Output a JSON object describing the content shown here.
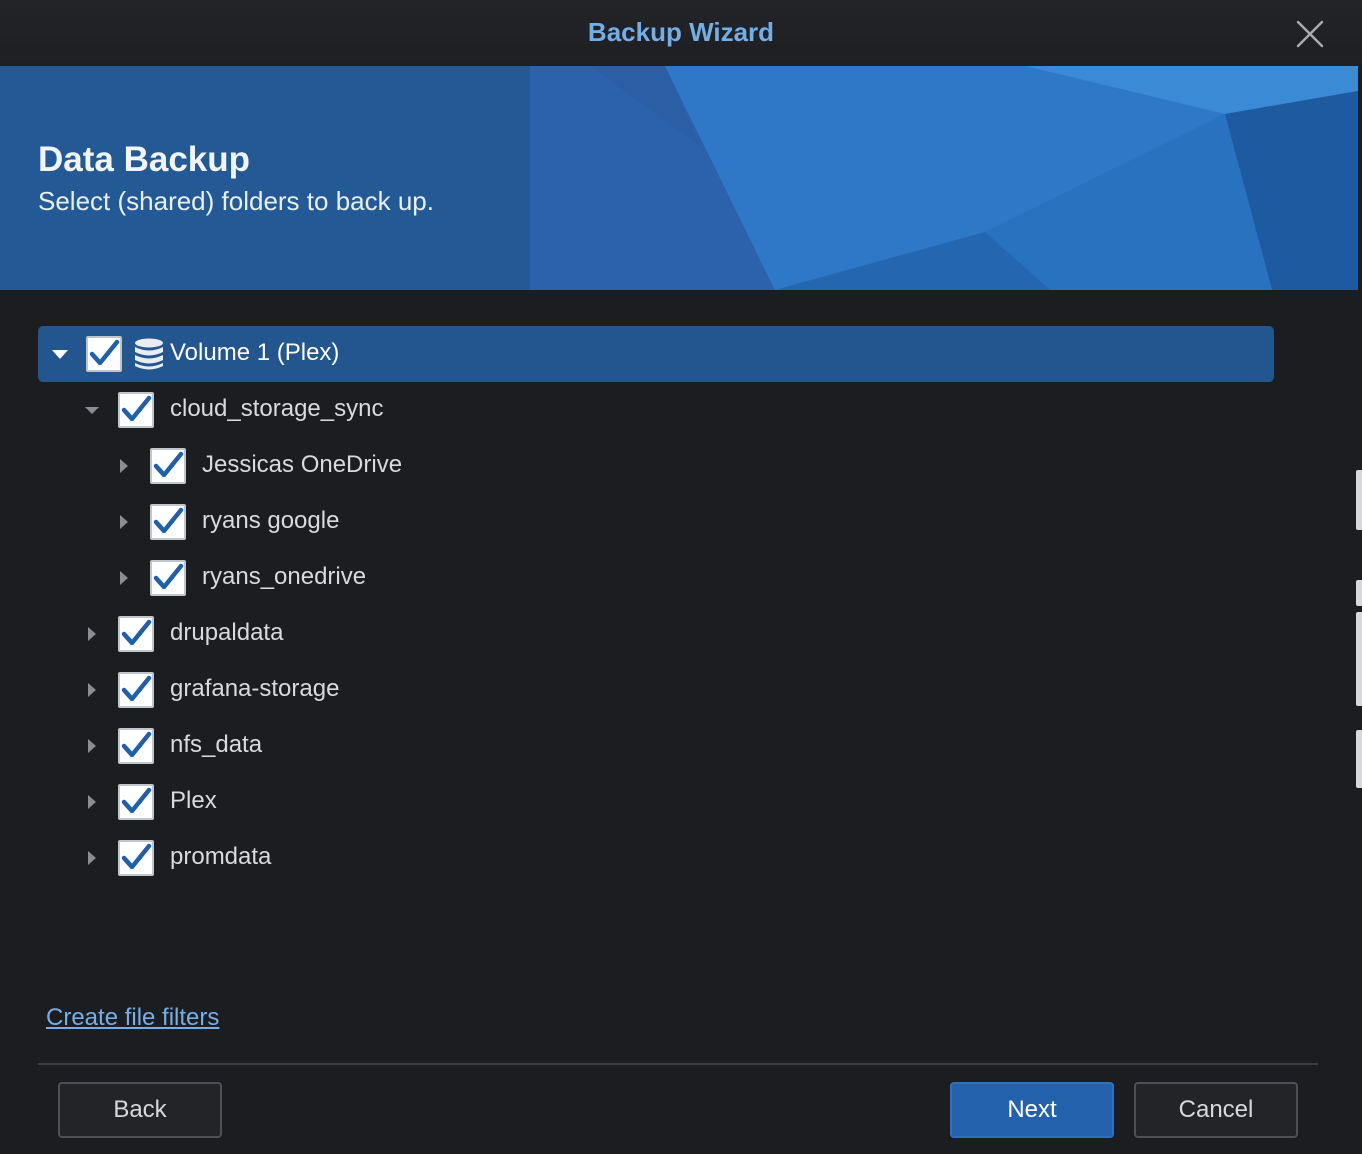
{
  "window": {
    "title": "Backup Wizard"
  },
  "header": {
    "heading": "Data Backup",
    "subheading": "Select (shared) folders to back up."
  },
  "tree": {
    "root": {
      "label": "Volume 1 (Plex)",
      "expanded": true,
      "checked": true
    },
    "folders": [
      {
        "label": "cloud_storage_sync",
        "expanded": true,
        "checked": true
      },
      {
        "label": "Jessicas OneDrive",
        "expanded": false,
        "checked": true
      },
      {
        "label": "ryans google",
        "expanded": false,
        "checked": true
      },
      {
        "label": "ryans_onedrive",
        "expanded": false,
        "checked": true
      },
      {
        "label": "drupaldata",
        "expanded": false,
        "checked": true
      },
      {
        "label": "grafana-storage",
        "expanded": false,
        "checked": true
      },
      {
        "label": "nfs_data",
        "expanded": false,
        "checked": true
      },
      {
        "label": "Plex",
        "expanded": false,
        "checked": true
      },
      {
        "label": "promdata",
        "expanded": false,
        "checked": true
      }
    ]
  },
  "footer": {
    "filters_link": "Create file filters",
    "back_label": "Back",
    "next_label": "Next",
    "cancel_label": "Cancel"
  },
  "colors": {
    "accent": "#2461ad",
    "title_text": "#74aee6",
    "banner": "#235a96",
    "background": "#1c1d20",
    "check_mark": "#1f5fae"
  },
  "icons": {
    "close": "close-icon",
    "expanded": "caret-down-icon",
    "collapsed": "caret-right-icon",
    "volume": "database-icon",
    "checkbox": "checkmark-icon"
  }
}
